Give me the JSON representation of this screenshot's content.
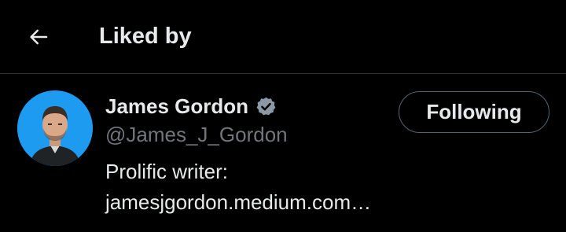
{
  "header": {
    "back_icon": "arrow-left-icon",
    "title": "Liked by"
  },
  "user": {
    "avatar_icon": "profile-photo",
    "name": "James Gordon",
    "verified_icon": "verified-badge-icon",
    "handle": "@James_J_Gordon",
    "bio_line1": "Prolific writer:",
    "bio_line2": "jamesjgordon.medium.com…",
    "follow_label": "Following"
  },
  "colors": {
    "background": "#000000",
    "primary_text": "#e7e9ea",
    "secondary_text": "#71767b",
    "divider": "#2f3336",
    "button_border": "#536471",
    "avatar_bg": "#1d9bf0"
  }
}
